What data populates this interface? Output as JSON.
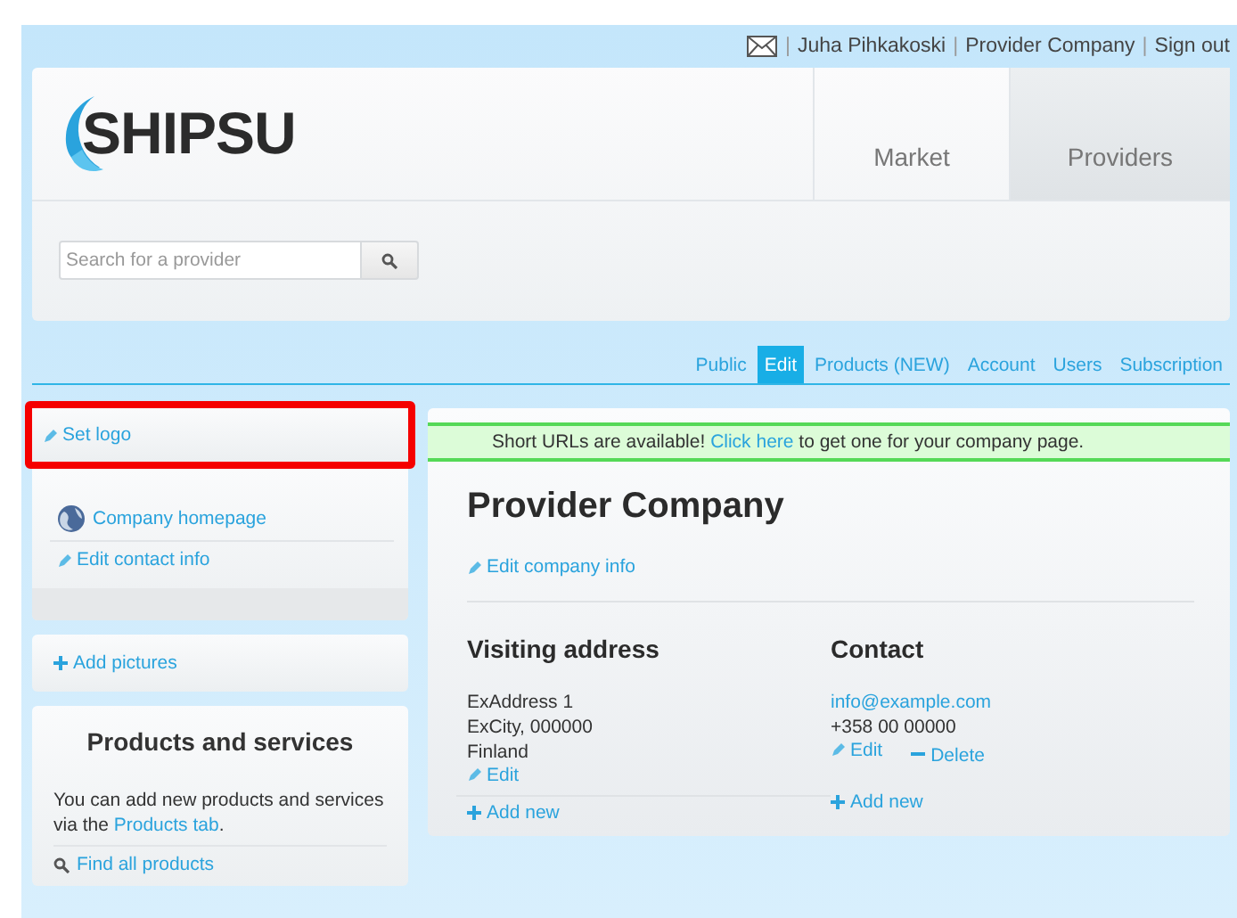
{
  "top_bar": {
    "links": [
      {
        "kind": "mail"
      },
      {
        "kind": "sep",
        "label": "|"
      },
      {
        "kind": "text",
        "label": "Juha Pihkakoski"
      },
      {
        "kind": "sep",
        "label": "|"
      },
      {
        "kind": "text",
        "label": "Provider Company"
      },
      {
        "kind": "sep",
        "label": "|"
      },
      {
        "kind": "text",
        "label": "Sign out"
      }
    ]
  },
  "header": {
    "logo": "SHIPSU",
    "nav_tabs": [
      {
        "label": "Market",
        "selected": false
      },
      {
        "label": "Providers",
        "selected": true
      }
    ],
    "search": {
      "placeholder": "Search for a provider"
    }
  },
  "sub_tabs": [
    {
      "label": "Public",
      "selected": false
    },
    {
      "label": "Edit",
      "selected": true
    },
    {
      "label": "Products (NEW)",
      "selected": false
    },
    {
      "label": "Account",
      "selected": false
    },
    {
      "label": "Users",
      "selected": false
    },
    {
      "label": "Subscription",
      "selected": false
    }
  ],
  "sidebar": {
    "set_logo": {
      "label": "Set logo",
      "highlighted": true
    },
    "links": [
      {
        "kind": "globe",
        "label": "Company homepage"
      },
      {
        "kind": "edit",
        "label": "Edit contact info"
      }
    ],
    "add_pictures": "Add pictures",
    "products": {
      "title": "Products and services",
      "text": "You can add new products and services via the ",
      "link": "Products tab",
      "text_end": ".",
      "find": "Find all products"
    }
  },
  "main": {
    "banner": {
      "text": "Short URLs are available! ",
      "link": "Click here",
      "text_end": " to get one for your company page."
    },
    "title": "Provider Company",
    "edit_info": "Edit company info",
    "address": {
      "title": "Visiting address",
      "lines": [
        "ExAddress 1",
        "ExCity, 000000",
        "Finland"
      ],
      "edit": "Edit",
      "add": "Add new"
    },
    "contact": {
      "title": "Contact",
      "email": "info@example.com",
      "phone": "+358 00 00000",
      "edit": "Edit",
      "delete": "Delete",
      "add": "Add new"
    }
  }
}
